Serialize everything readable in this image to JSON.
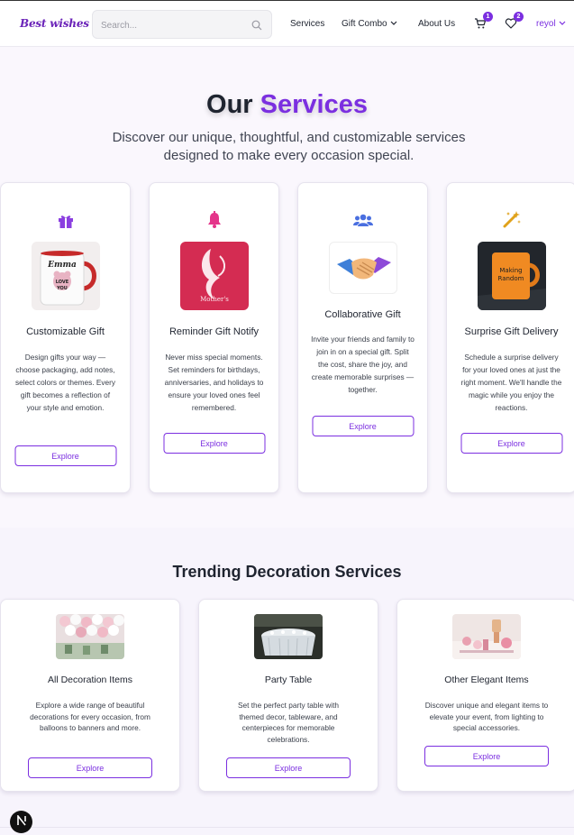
{
  "header": {
    "logo": "Best wishes",
    "search_placeholder": "Search...",
    "nav": {
      "services": "Services",
      "gift_combo": "Gift Combo",
      "about_us": "About Us"
    },
    "cart_count": "1",
    "wishlist_count": "2",
    "user": "reyol"
  },
  "services": {
    "title_part1": "Our",
    "title_part2": "Services",
    "subtitle": "Discover our unique, thoughtful, and customizable services designed to make every occasion special.",
    "cards": [
      {
        "icon": "gift-icon",
        "title": "Customizable Gift",
        "description": "Design gifts your way — choose packaging, add notes, select colors or themes. Every gift becomes a reflection of your style and emotion.",
        "button": "Explore",
        "image_text": [
          "Emma",
          "LOVE",
          "YOU"
        ]
      },
      {
        "icon": "bell-icon",
        "title": "Reminder Gift Notify",
        "description": "Never miss special moments. Set reminders for birthdays, anniversaries, and holidays to ensure your loved ones feel remembered.",
        "button": "Explore",
        "image_text": [
          "Mother's"
        ]
      },
      {
        "icon": "users-icon",
        "title": "Collaborative Gift",
        "description": "Invite your friends and family to join in on a special gift. Split the cost, share the joy, and create memorable surprises — together.",
        "button": "Explore"
      },
      {
        "icon": "magic-wand-icon",
        "title": "Surprise Gift Delivery",
        "description": "Schedule a surprise delivery for your loved ones at just the right moment. We'll handle the magic while you enjoy the reactions.",
        "button": "Explore",
        "image_text": [
          "Making",
          "Random"
        ]
      }
    ]
  },
  "trending": {
    "title": "Trending Decoration Services",
    "cards": [
      {
        "title": "All Decoration Items",
        "description": "Explore a wide range of beautiful decorations for every occasion, from balloons to banners and more.",
        "button": "Explore"
      },
      {
        "title": "Party Table",
        "description": "Set the perfect party table with themed decor, tableware, and centerpieces for memorable celebrations.",
        "button": "Explore"
      },
      {
        "title": "Other Elegant Items",
        "description": "Discover unique and elegant items to elevate your event, from lighting to special accessories.",
        "button": "Explore"
      }
    ]
  },
  "colors": {
    "accent": "#7b2fe0",
    "gift_icon": "#8b3fe0",
    "bell_icon": "#e4358a",
    "users_icon": "#4a6fe0",
    "wand_icon": "#e0a21a"
  },
  "fab_letter": "N"
}
